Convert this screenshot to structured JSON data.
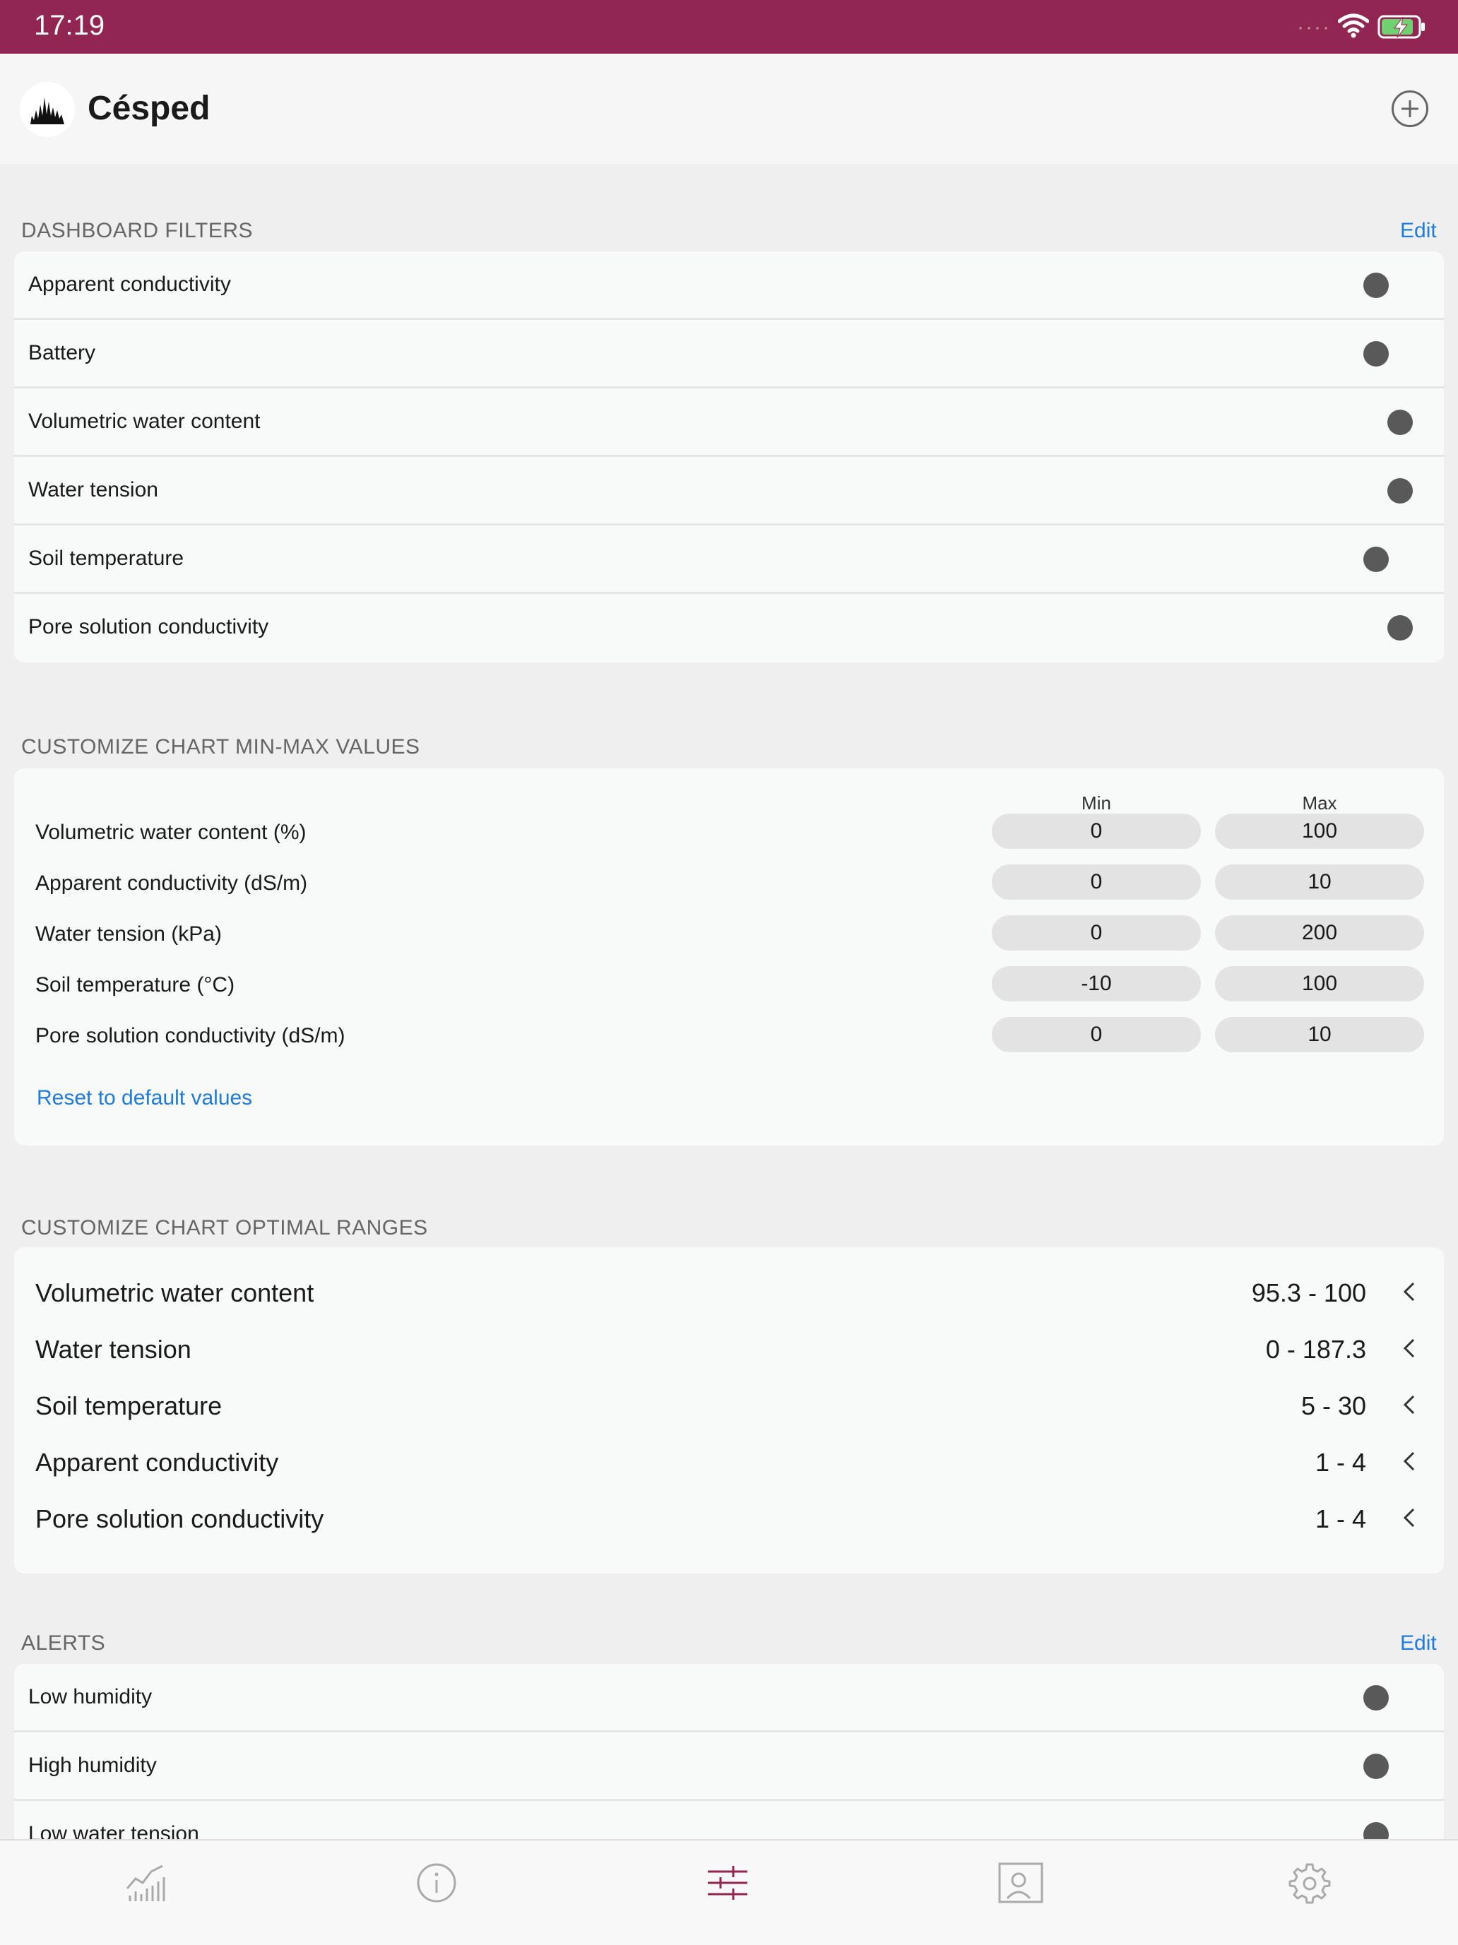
{
  "status_bar": {
    "time": "17:19",
    "signal_dots": "····"
  },
  "header": {
    "title": "Césped",
    "logo_icon": "turf-logo-icon",
    "add_icon": "add-circle-icon"
  },
  "dashboard_filters": {
    "label": "DASHBOARD FILTERS",
    "edit_label": "Edit",
    "items": [
      {
        "label": "Apparent conductivity",
        "on": false
      },
      {
        "label": "Battery",
        "on": false
      },
      {
        "label": "Volumetric water content",
        "on": false
      },
      {
        "label": "Water tension",
        "on": false
      },
      {
        "label": "Soil temperature",
        "on": false
      },
      {
        "label": "Pore solution conductivity",
        "on": false
      }
    ]
  },
  "min_max": {
    "label": "CUSTOMIZE CHART MIN-MAX VALUES",
    "min_header": "Min",
    "max_header": "Max",
    "rows": [
      {
        "label": "Volumetric water content (%)",
        "min": "0",
        "max": "100"
      },
      {
        "label": "Apparent conductivity (dS/m)",
        "min": "0",
        "max": "10"
      },
      {
        "label": "Water tension (kPa)",
        "min": "0",
        "max": "200"
      },
      {
        "label": "Soil temperature (°C)",
        "min": "-10",
        "max": "100"
      },
      {
        "label": "Pore solution conductivity (dS/m)",
        "min": "0",
        "max": "10"
      }
    ],
    "reset_label": "Reset to default values"
  },
  "optimal_ranges": {
    "label": "CUSTOMIZE CHART OPTIMAL RANGES",
    "rows": [
      {
        "label": "Volumetric water content",
        "value": "95.3 - 100"
      },
      {
        "label": "Water tension",
        "value": "0 - 187.3"
      },
      {
        "label": "Soil temperature",
        "value": "5 - 30"
      },
      {
        "label": "Apparent conductivity",
        "value": "1 - 4"
      },
      {
        "label": "Pore solution conductivity",
        "value": "1 - 4"
      }
    ]
  },
  "alerts": {
    "label": "ALERTS",
    "edit_label": "Edit",
    "items": [
      {
        "label": "Low humidity",
        "on": false
      },
      {
        "label": "High humidity",
        "on": false
      },
      {
        "label": "Low water tension",
        "on": false
      }
    ]
  },
  "tab_bar": {
    "tabs": [
      {
        "icon": "chart-icon",
        "active": false
      },
      {
        "icon": "info-icon",
        "active": false
      },
      {
        "icon": "sliders-icon",
        "active": true
      },
      {
        "icon": "contact-icon",
        "active": false
      },
      {
        "icon": "gear-icon",
        "active": false
      }
    ]
  },
  "colors": {
    "brand": "#922652",
    "link": "#1f7bde",
    "toggle_off": "#595959"
  }
}
